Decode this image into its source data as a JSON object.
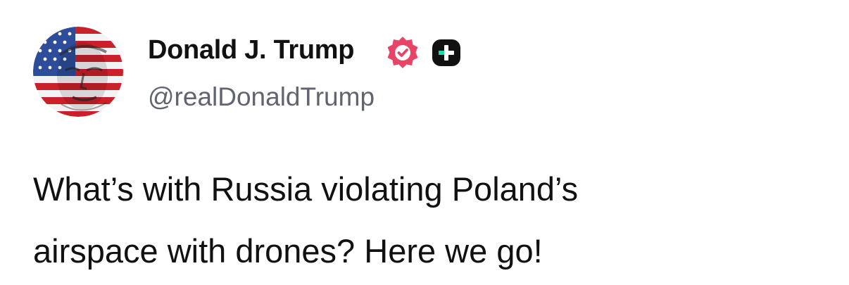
{
  "author": {
    "display_name": "Donald J. Trump",
    "handle": "@realDonaldTrump",
    "avatar_icon": "flag-portrait-avatar",
    "verified_icon": "verified-badge-icon",
    "plus_icon": "plus-square-icon"
  },
  "post": {
    "lines": [
      "What’s with Russia violating Poland’s",
      "airspace with drones? Here we go!"
    ]
  },
  "colors": {
    "verified_badge": "#e84566",
    "plus_badge": "#111111",
    "plus_badge_accent": "#2bd1a8",
    "handle_text": "#5f6470"
  }
}
